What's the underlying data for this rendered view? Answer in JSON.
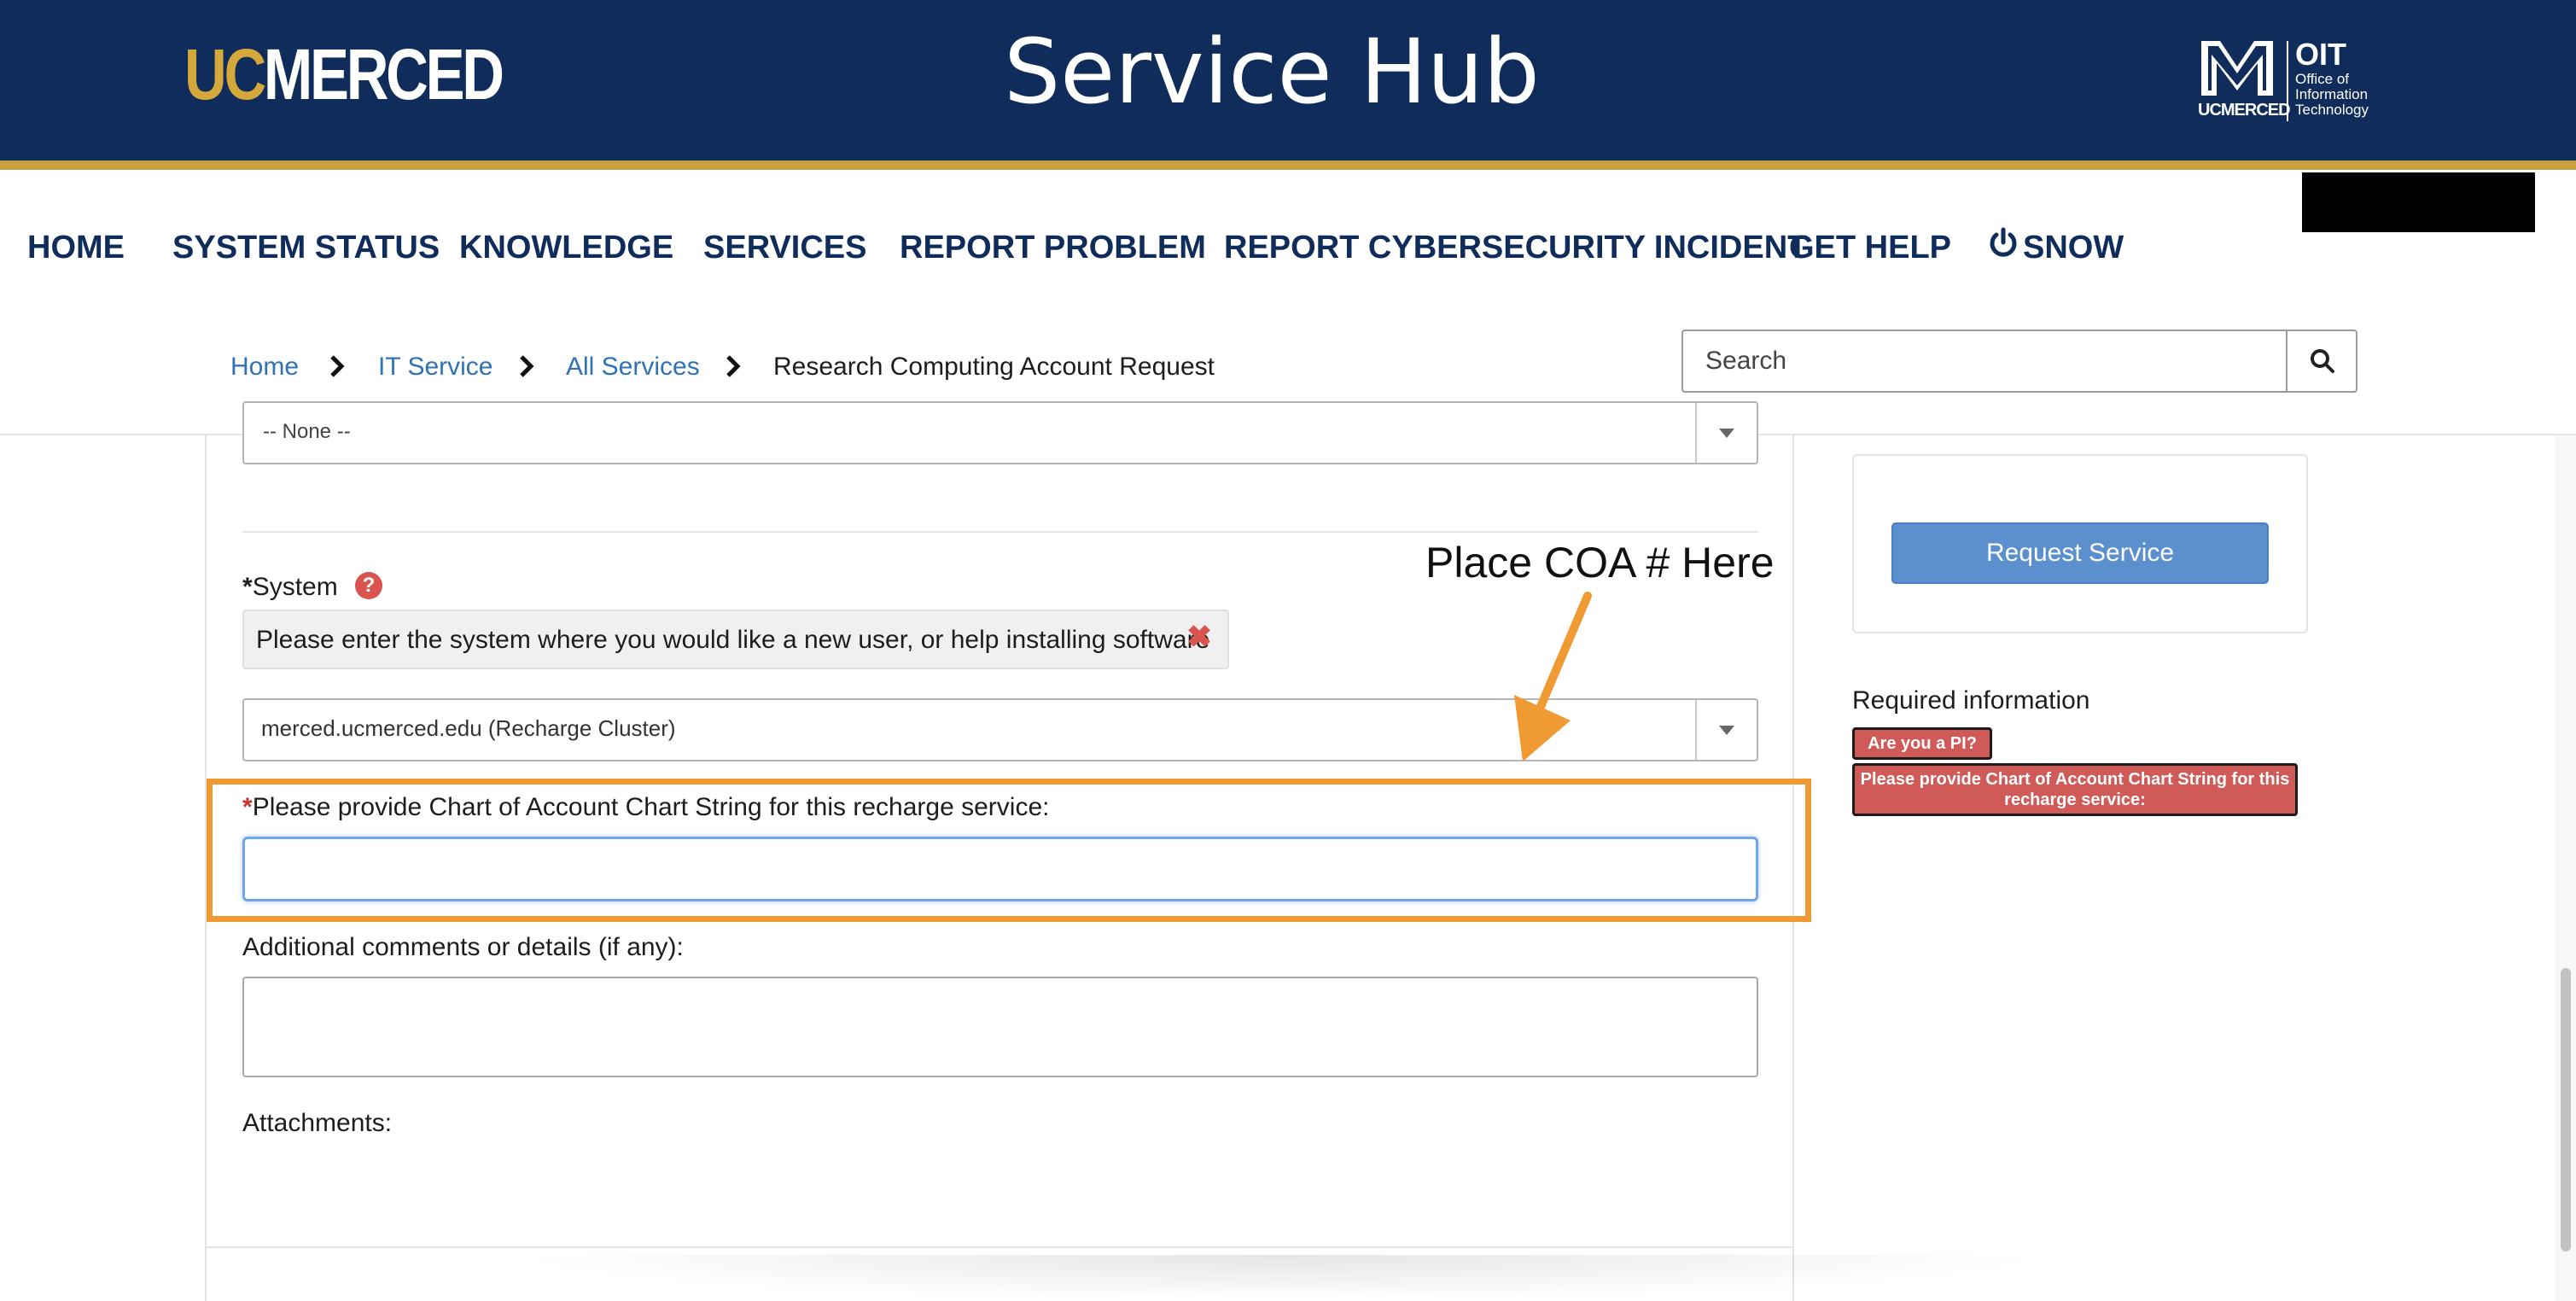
{
  "header": {
    "logo_uc": "UC",
    "logo_merced": "MERCED",
    "title": "Service Hub",
    "oit_logo_text": "OIT",
    "oit_logo_subtitle": "Office of\nInformation\nTechnology",
    "oit_logo_m_caption": "UCMERCED",
    "brand_navy": "#0f2c5b",
    "brand_gold": "#c9a13b"
  },
  "nav": {
    "items": [
      "HOME",
      "SYSTEM STATUS",
      "KNOWLEDGE",
      "SERVICES",
      "REPORT PROBLEM",
      "REPORT CYBERSECURITY INCIDENT",
      "GET HELP",
      "SNOW"
    ],
    "snow_icon": "power-icon"
  },
  "breadcrumb": {
    "items": [
      "Home",
      "IT Service",
      "All Services",
      "Research Computing Account Request"
    ],
    "separator_icon": "chevron-right-icon"
  },
  "search": {
    "placeholder": "Search",
    "button_icon": "search-icon"
  },
  "form": {
    "none_select_value": "-- None --",
    "system_label": "System",
    "system_required_mark": "*",
    "system_help_icon": "question-circle-icon",
    "system_tag_text": "Please enter the system where you would like a new user, or help installing software",
    "system_tag_remove_icon": "close-icon",
    "system_select_value": "merced.ucmerced.edu (Recharge Cluster)",
    "coa_required_mark": "*",
    "coa_label": "Please provide Chart of Account Chart String for this recharge service:",
    "coa_value": "",
    "comments_label": "Additional comments or details (if any):",
    "comments_value": "",
    "attachments_label": "Attachments:"
  },
  "annotation": {
    "text": "Place COA # Here",
    "color": "#ef9a33"
  },
  "sidebar": {
    "request_button": "Request Service",
    "required_title": "Required information",
    "required_items": [
      "Are you a PI?",
      "Please provide Chart of Account Chart String for this recharge service:"
    ]
  }
}
